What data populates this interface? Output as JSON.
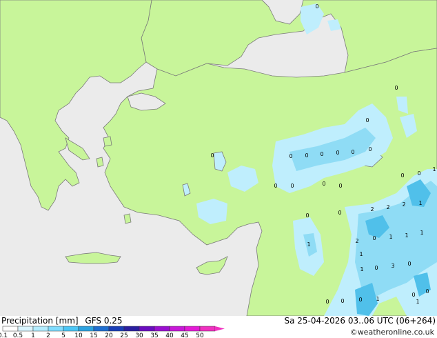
{
  "header": {
    "product": "Precipitation [mm]",
    "model": "GFS 0.25",
    "valid_time": "Sa 25-04-2026 03..06 UTC (06+264)"
  },
  "credit": "©weatheronline.co.uk",
  "legend": {
    "values": [
      "0.1",
      "0.5",
      "1",
      "2",
      "5",
      "10",
      "15",
      "20",
      "25",
      "30",
      "35",
      "40",
      "45",
      "50"
    ],
    "colors": [
      "#ffffff",
      "#d9f5ff",
      "#b3ecff",
      "#80dcff",
      "#4cc6f5",
      "#2ea3e0",
      "#1f6fd0",
      "#1a3fb8",
      "#2a1fa0",
      "#6a0dbf",
      "#9a0fd0",
      "#c818d8",
      "#e41ad6",
      "#f030c0"
    ]
  },
  "colors": {
    "land": "#c8f59a",
    "sea": "#ebebeb",
    "coast": "#7a7a7a",
    "rain_light": "#bfeefd",
    "rain_mod": "#8fdcf5",
    "rain_heavy": "#50c0ea"
  },
  "map_labels": [
    {
      "text": "0"
    },
    {
      "text": "0"
    },
    {
      "text": "0"
    },
    {
      "text": "0"
    },
    {
      "text": "0"
    },
    {
      "text": "0"
    },
    {
      "text": "0"
    },
    {
      "text": "0"
    },
    {
      "text": "0"
    },
    {
      "text": "0"
    },
    {
      "text": "0"
    },
    {
      "text": "0"
    },
    {
      "text": "0"
    },
    {
      "text": "0"
    },
    {
      "text": "0"
    },
    {
      "text": "0"
    },
    {
      "text": "0"
    },
    {
      "text": "1"
    },
    {
      "text": "0"
    },
    {
      "text": "2"
    },
    {
      "text": "2"
    },
    {
      "text": "2"
    },
    {
      "text": "1"
    },
    {
      "text": "2"
    },
    {
      "text": "0"
    },
    {
      "text": "1"
    },
    {
      "text": "1"
    },
    {
      "text": "1"
    },
    {
      "text": "1"
    },
    {
      "text": "1"
    },
    {
      "text": "1"
    },
    {
      "text": "0"
    },
    {
      "text": "3"
    },
    {
      "text": "0"
    },
    {
      "text": "0"
    },
    {
      "text": "0"
    },
    {
      "text": "0"
    },
    {
      "text": "0"
    },
    {
      "text": "0"
    },
    {
      "text": "1"
    },
    {
      "text": "1"
    }
  ]
}
